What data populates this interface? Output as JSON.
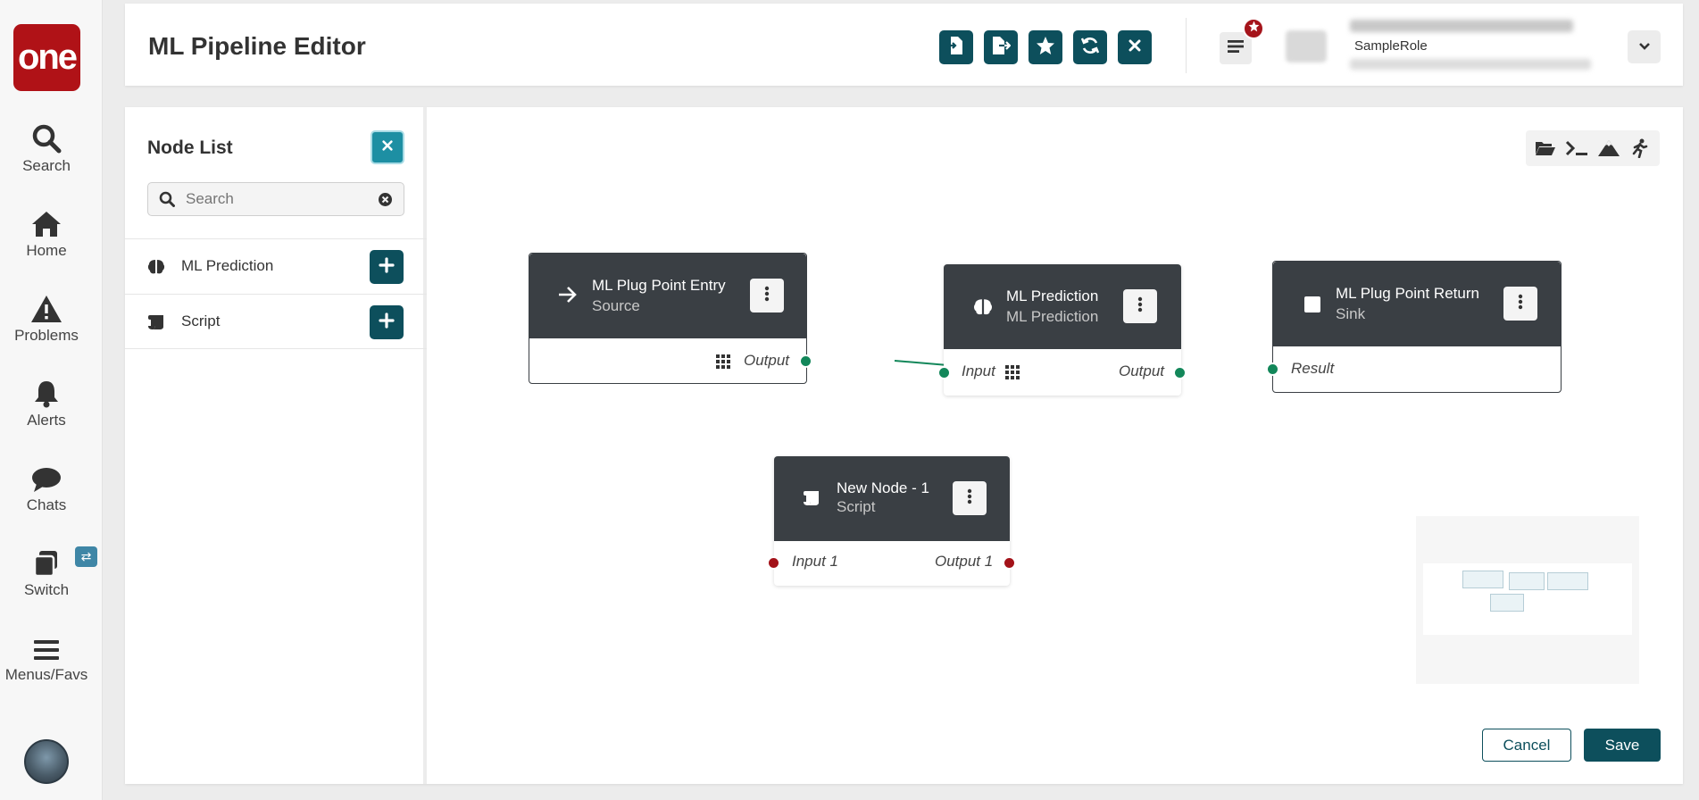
{
  "nav": {
    "logo_text": "one",
    "items": [
      {
        "label": "Search",
        "icon": "search-icon"
      },
      {
        "label": "Home",
        "icon": "home-icon"
      },
      {
        "label": "Problems",
        "icon": "warning-icon"
      },
      {
        "label": "Alerts",
        "icon": "bell-icon"
      },
      {
        "label": "Chats",
        "icon": "chat-icon"
      },
      {
        "label": "Switch",
        "icon": "switch-icon"
      },
      {
        "label": "Menus/Favs",
        "icon": "hamburger-icon"
      }
    ],
    "switch_badge": "⇄"
  },
  "header": {
    "title": "ML Pipeline Editor",
    "toolbar": [
      "import-icon",
      "export-icon",
      "star-icon",
      "refresh-icon",
      "close-icon"
    ],
    "user_role": "SampleRole"
  },
  "node_list": {
    "title": "Node List",
    "search_placeholder": "Search",
    "items": [
      {
        "label": "ML Prediction",
        "icon": "brain-icon"
      },
      {
        "label": "Script",
        "icon": "script-icon"
      }
    ]
  },
  "canvas": {
    "tools": [
      "folder-open-icon",
      "terminal-icon",
      "mountain-icon",
      "running-icon"
    ],
    "nodes": [
      {
        "title": "ML Plug Point Entry",
        "subtitle": "Source",
        "output": "Output"
      },
      {
        "title": "ML Prediction",
        "subtitle": "ML Prediction",
        "input": "Input",
        "output": "Output"
      },
      {
        "title": "ML Plug Point Return",
        "subtitle": "Sink",
        "input": "Result"
      },
      {
        "title": "New Node - 1",
        "subtitle": "Script",
        "input": "Input 1",
        "output": "Output 1"
      }
    ]
  },
  "actions": {
    "cancel": "Cancel",
    "save": "Save"
  },
  "colors": {
    "primary": "#0d4f5c",
    "node_header": "#3a3f44",
    "port_connected": "#13875a",
    "port_unconnected": "#a31219",
    "brand": "#b01217"
  }
}
